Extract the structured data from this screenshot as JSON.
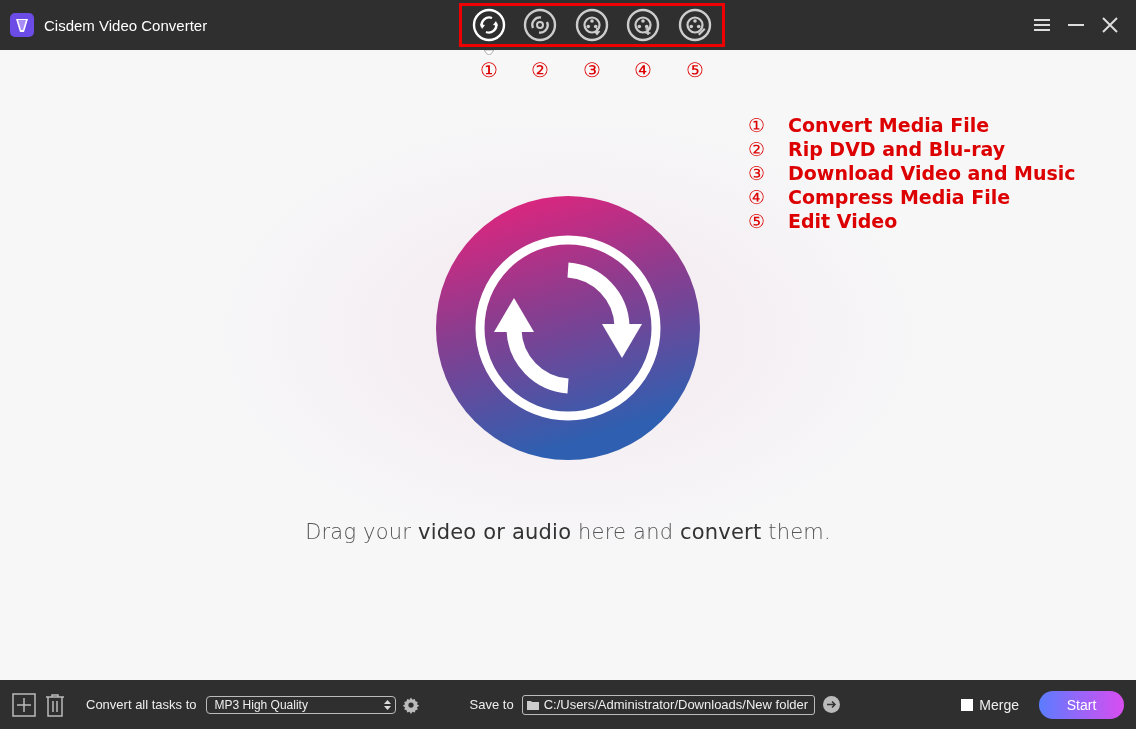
{
  "window": {
    "title": "Cisdem Video Converter"
  },
  "modes": [
    {
      "kind": "convert",
      "number": "①",
      "selected": true
    },
    {
      "kind": "rip",
      "number": "②",
      "selected": false
    },
    {
      "kind": "download",
      "number": "③",
      "selected": false
    },
    {
      "kind": "compress",
      "number": "④",
      "selected": false
    },
    {
      "kind": "edit",
      "number": "⑤",
      "selected": false
    }
  ],
  "legend": [
    {
      "number": "①",
      "label": "Convert Media File"
    },
    {
      "number": "②",
      "label": "Rip DVD and Blu-ray"
    },
    {
      "number": "③",
      "label": "Download Video and Music"
    },
    {
      "number": "④",
      "label": "Compress Media File"
    },
    {
      "number": "⑤",
      "label": "Edit Video"
    }
  ],
  "drop_hint": "Drag your **video or audio** here and **convert** them.",
  "bottom_bar": {
    "convert_label": "Convert all tasks to",
    "format": "MP3 High Quality",
    "save_label": "Save to",
    "save_path": "C:/Users/Administrator/Downloads/New folder",
    "merge": {
      "label": "Merge",
      "checked": false
    },
    "start": "Start"
  }
}
